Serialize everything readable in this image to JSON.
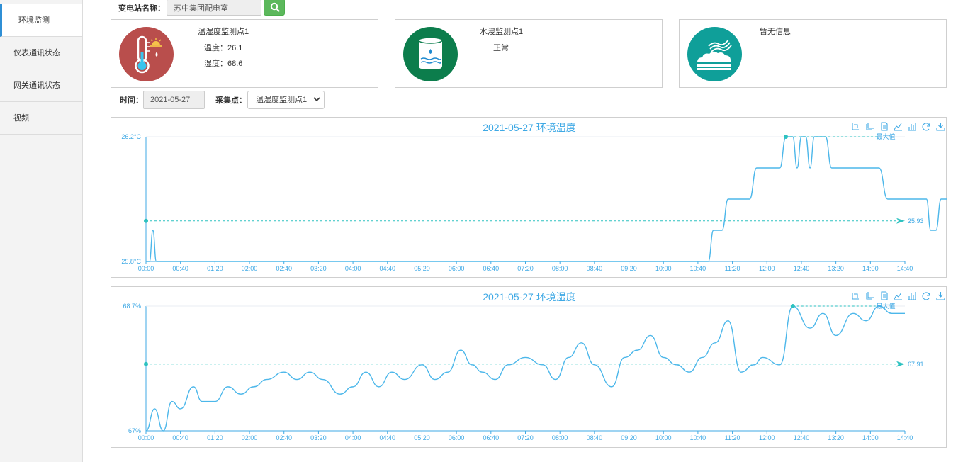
{
  "sidebar": {
    "items": [
      {
        "label": "环境监测",
        "active": true
      },
      {
        "label": "仪表通讯状态",
        "active": false
      },
      {
        "label": "网关通讯状态",
        "active": false
      },
      {
        "label": "视频",
        "active": false
      }
    ]
  },
  "search": {
    "station_label": "变电站名称：",
    "station_value": "苏中集团配电室",
    "button_icon": "search-icon"
  },
  "cards": [
    {
      "title": "温湿度监测点1",
      "line1": "温度：26.1",
      "line2": "湿度：68.6",
      "icon": "thermometer-icon",
      "color": "#b94e4c"
    },
    {
      "title": "水浸监测点1",
      "line1": "正常",
      "icon": "water-tank-icon",
      "color": "#0c7d4c"
    },
    {
      "title": "暂无信息",
      "icon": "smoke-icon",
      "color": "#0f9f99"
    }
  ],
  "filters": {
    "time_label": "时间：",
    "time_value": "2021-05-27",
    "point_label": "采集点：",
    "point_value": "温湿度监测点1"
  },
  "chart_data": [
    {
      "type": "line",
      "title": "2021-05-27 环境温度",
      "x_ticks": [
        "00:00",
        "00:40",
        "01:20",
        "02:00",
        "02:40",
        "03:20",
        "04:00",
        "04:40",
        "05:20",
        "06:00",
        "06:40",
        "07:20",
        "08:00",
        "08:40",
        "09:20",
        "10:00",
        "10:40",
        "11:20",
        "12:00",
        "12:40",
        "13:20",
        "14:00",
        "14:40"
      ],
      "y_ticks": [
        "25.8°C",
        "26.2°C"
      ],
      "ylim": [
        25.8,
        26.2
      ],
      "xlim_minutes": [
        0,
        880
      ],
      "series": [
        {
          "points": [
            [
              0,
              25.8
            ],
            [
              4,
              25.8
            ],
            [
              8,
              25.9
            ],
            [
              12,
              25.8
            ],
            [
              40,
              25.8
            ],
            [
              200,
              25.8
            ],
            [
              400,
              25.8
            ],
            [
              600,
              25.8
            ],
            [
              640,
              25.8
            ],
            [
              652,
              25.8
            ],
            [
              658,
              25.9
            ],
            [
              668,
              25.9
            ],
            [
              675,
              26.0
            ],
            [
              690,
              26.0
            ],
            [
              700,
              26.0
            ],
            [
              708,
              26.1
            ],
            [
              722,
              26.1
            ],
            [
              735,
              26.1
            ],
            [
              742,
              26.2
            ],
            [
              750,
              26.2
            ],
            [
              755,
              26.1
            ],
            [
              760,
              26.2
            ],
            [
              765,
              26.2
            ],
            [
              770,
              26.1
            ],
            [
              775,
              26.2
            ],
            [
              788,
              26.2
            ],
            [
              795,
              26.1
            ],
            [
              850,
              26.1
            ],
            [
              860,
              26.0
            ],
            [
              905,
              26.0
            ],
            [
              910,
              25.9
            ],
            [
              916,
              25.9
            ],
            [
              922,
              26.0
            ],
            [
              960,
              26.0
            ],
            [
              965,
              26.1
            ],
            [
              972,
              26.0
            ],
            [
              980,
              26.1
            ],
            [
              1000,
              26.1
            ],
            [
              1050,
              26.1
            ],
            [
              1085,
              26.1
            ]
          ]
        }
      ],
      "mark_point": {
        "label": "最大值",
        "value": 26.2
      },
      "mark_line": {
        "label": "25.93",
        "value": 25.93
      }
    },
    {
      "type": "line",
      "title": "2021-05-27 环境湿度",
      "x_ticks": [
        "00:00",
        "00:40",
        "01:20",
        "02:00",
        "02:40",
        "03:20",
        "04:00",
        "04:40",
        "05:20",
        "06:00",
        "06:40",
        "07:20",
        "08:00",
        "08:40",
        "09:20",
        "10:00",
        "10:40",
        "11:20",
        "12:00",
        "12:40",
        "13:20",
        "14:00",
        "14:40"
      ],
      "y_ticks": [
        "67%",
        "68.7%"
      ],
      "ylim": [
        67,
        68.7
      ],
      "xlim_minutes": [
        0,
        880
      ],
      "series": [
        {
          "points": [
            [
              0,
              67.0
            ],
            [
              10,
              67.3
            ],
            [
              20,
              67.0
            ],
            [
              30,
              67.4
            ],
            [
              40,
              67.3
            ],
            [
              55,
              67.6
            ],
            [
              65,
              67.4
            ],
            [
              80,
              67.4
            ],
            [
              95,
              67.6
            ],
            [
              110,
              67.5
            ],
            [
              125,
              67.6
            ],
            [
              140,
              67.7
            ],
            [
              160,
              67.8
            ],
            [
              175,
              67.7
            ],
            [
              190,
              67.8
            ],
            [
              205,
              67.7
            ],
            [
              225,
              67.5
            ],
            [
              240,
              67.6
            ],
            [
              255,
              67.8
            ],
            [
              270,
              67.6
            ],
            [
              285,
              67.8
            ],
            [
              300,
              67.7
            ],
            [
              320,
              67.9
            ],
            [
              335,
              67.7
            ],
            [
              350,
              67.8
            ],
            [
              365,
              68.1
            ],
            [
              378,
              67.9
            ],
            [
              390,
              67.8
            ],
            [
              405,
              67.7
            ],
            [
              420,
              67.9
            ],
            [
              440,
              68.0
            ],
            [
              460,
              67.9
            ],
            [
              475,
              67.7
            ],
            [
              490,
              68.0
            ],
            [
              505,
              68.2
            ],
            [
              520,
              67.9
            ],
            [
              540,
              67.6
            ],
            [
              555,
              68.0
            ],
            [
              570,
              68.1
            ],
            [
              585,
              68.3
            ],
            [
              600,
              68.0
            ],
            [
              615,
              67.9
            ],
            [
              630,
              67.8
            ],
            [
              645,
              68.0
            ],
            [
              660,
              68.2
            ],
            [
              675,
              68.5
            ],
            [
              690,
              67.8
            ],
            [
              705,
              67.9
            ],
            [
              715,
              68.0
            ],
            [
              735,
              67.9
            ],
            [
              750,
              68.7
            ],
            [
              770,
              68.4
            ],
            [
              785,
              68.6
            ],
            [
              800,
              68.3
            ],
            [
              820,
              68.6
            ],
            [
              835,
              68.5
            ],
            [
              850,
              68.7
            ],
            [
              865,
              68.6
            ],
            [
              880,
              68.6
            ]
          ]
        }
      ],
      "mark_point": {
        "label": "最大值",
        "value": 68.7
      },
      "mark_line": {
        "label": "67.91",
        "value": 67.91
      }
    }
  ]
}
